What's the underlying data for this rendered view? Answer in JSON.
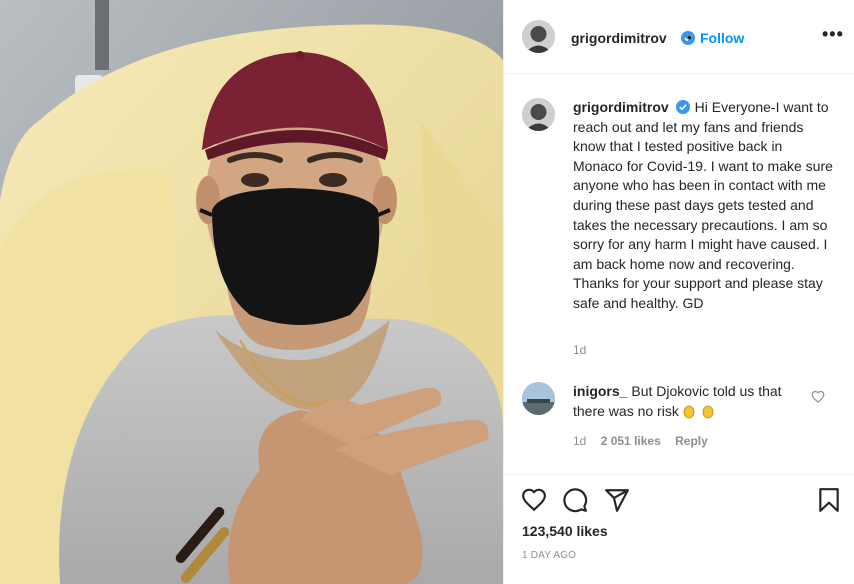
{
  "post": {
    "username": "grigordimitrov",
    "follow_label": "Follow",
    "separator": "•",
    "more_label": "•••",
    "caption": "Hi Everyone-I want to reach out and let my fans and friends know that I tested positive back in Monaco for Covid-19. I want to make sure anyone who has been in contact with me during these past days gets tested and takes the necessary precautions. I am so sorry for any harm I might have caused. I am back home now and recovering. Thanks for your support and please stay safe and healthy. GD",
    "caption_time": "1d",
    "likes": "123,540 likes",
    "posted": "1 DAY AGO"
  },
  "comment": {
    "username": "inigors_",
    "text": "But Djokovic told us that there was no risk",
    "emoji": "clapping-hands",
    "time": "1d",
    "likes": "2 051 likes",
    "reply_label": "Reply"
  },
  "icons": {
    "like": "heart-icon",
    "comment": "comment-bubble-icon",
    "share": "paper-plane-icon",
    "save": "bookmark-icon",
    "verified": "verified-badge-icon",
    "comment_like": "small-heart-icon"
  },
  "colors": {
    "accent": "#0095f6",
    "text": "#262626",
    "muted": "#8e8e8e",
    "border": "#efefef"
  }
}
